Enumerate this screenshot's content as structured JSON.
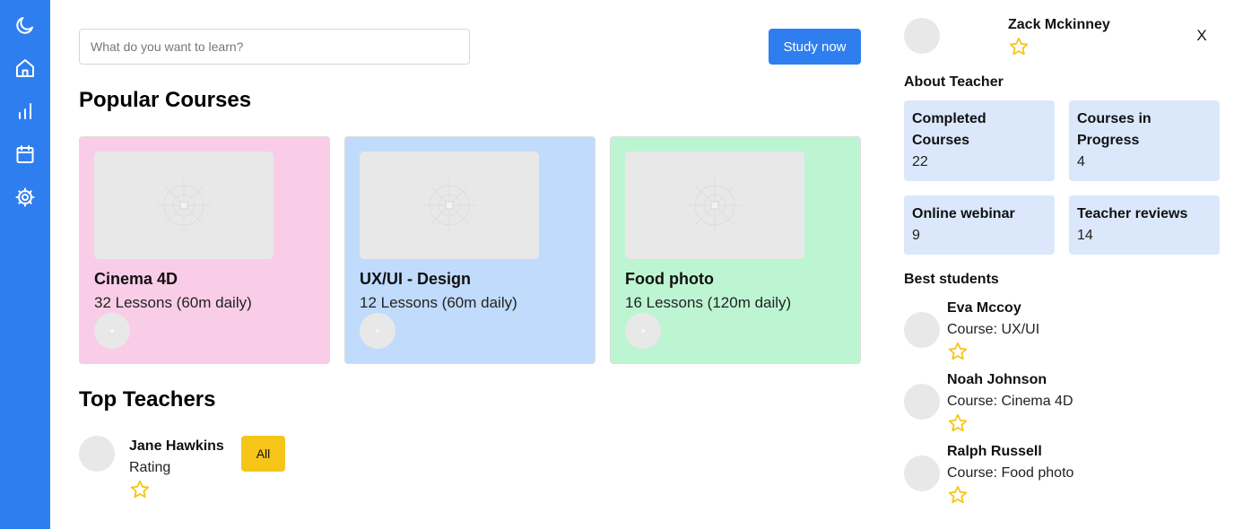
{
  "sidebar": {
    "icons": [
      "moon-icon",
      "home-icon",
      "bar-chart-icon",
      "calendar-icon",
      "settings-icon"
    ],
    "color": "#2f7ef0"
  },
  "search": {
    "placeholder": "What do you want to learn?",
    "value": ""
  },
  "study_button": {
    "label": "Study now"
  },
  "popular": {
    "title": "Popular Courses",
    "courses": [
      {
        "title": "Cinema 4D",
        "lessons": "32 Lessons (60m daily)",
        "color": "#f9cde7"
      },
      {
        "title": "UX/UI - Design",
        "lessons": "12 Lessons (60m daily)",
        "color": "#c0dbfb"
      },
      {
        "title": "Food photo",
        "lessons": "16 Lessons (120m daily)",
        "color": "#bdf5d2"
      }
    ]
  },
  "top_teachers": {
    "title": "Top Teachers",
    "teacher": {
      "name": "Jane Hawkins",
      "rating_label": "Rating"
    },
    "all_button": "All"
  },
  "profile": {
    "name": "Zack Mckinney",
    "close_label": "X",
    "about_title": "About Teacher",
    "stats": [
      {
        "label": "Completed Courses",
        "value": "22"
      },
      {
        "label": "Courses in Progress",
        "value": "4"
      },
      {
        "label": "Online webinar",
        "value": "9"
      },
      {
        "label": "Teacher reviews",
        "value": "14"
      }
    ],
    "best_students_title": "Best students",
    "students": [
      {
        "name": "Eva Mccoy",
        "course": "Course: UX/UI"
      },
      {
        "name": "Noah Johnson",
        "course": "Course: Cinema 4D"
      },
      {
        "name": "Ralph Russell",
        "course": "Course: Food photo"
      }
    ]
  },
  "colors": {
    "accent": "#2f7ef0",
    "star": "#f5c518",
    "stat_bg": "#dbe8fb"
  }
}
